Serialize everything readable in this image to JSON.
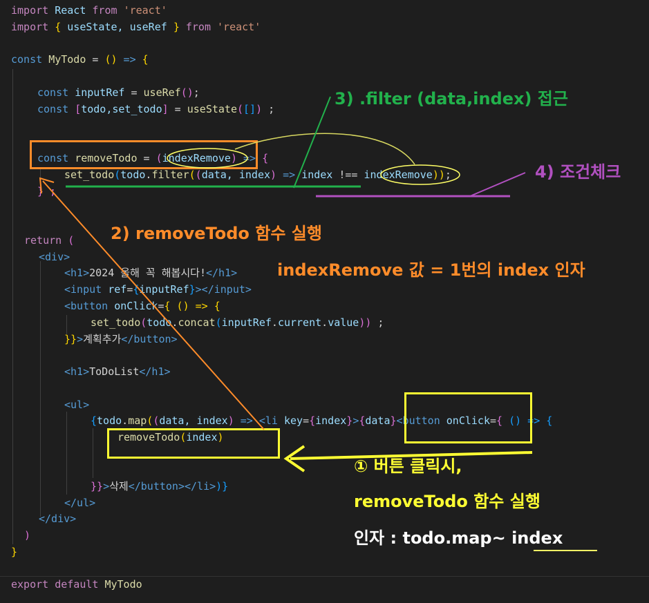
{
  "code": {
    "l1_import": "import",
    "l1_react": "React",
    "l1_from": "from",
    "l1_str": "'react'",
    "l2_import": "import",
    "l2_brace_open": "{",
    "l2_names": " useState, useRef ",
    "l2_brace_close": "}",
    "l2_from": "from",
    "l2_str": "'react'",
    "l3_const": "const",
    "l3_name": "MyTodo",
    "l3_eq": " = ",
    "l3_parens": "()",
    "l3_arrow": " => ",
    "l3_brace": "{",
    "l4_const": "const",
    "l4_var": "inputRef",
    "l4_eq": " = ",
    "l4_fn": "useRef",
    "l4_parens": "()",
    "l4_semi": ";",
    "l5_const": "const",
    "l5_open": "[",
    "l5_vars": "todo,set_todo",
    "l5_close": "]",
    "l5_eq": " = ",
    "l5_fn": "useState",
    "l5_p1": "(",
    "l5_arr": "[]",
    "l5_p2": ")",
    "l5_semi": " ;",
    "l6_const": "const",
    "l6_name": "removeTodo",
    "l6_eq": " = ",
    "l6_p1": "(",
    "l6_param": "indexRemove",
    "l6_p2": ")",
    "l6_arrow": " => ",
    "l6_brace": "{",
    "l7_fn": "set_todo",
    "l7_p1": "(",
    "l7_todo": "todo",
    "l7_dot": ".",
    "l7_filter": "filter",
    "l7_p2": "(",
    "l7_p3": "(",
    "l7_params": "data, index",
    "l7_p4": ")",
    "l7_arrow": " => ",
    "l7_index": "index",
    "l7_op": " !== ",
    "l7_ir": "indexRemove",
    "l7_p5": "))",
    "l7_semi": ";",
    "l8_close": "} ;",
    "l9_return": "return",
    "l9_paren": " (",
    "l10_div": "<div>",
    "l11_open": "<h1>",
    "l11_text": "2024 올해 꼭 해봅시다!",
    "l11_close": "</h1>",
    "l12_open": "<input",
    "l12_attr": " ref",
    "l12_eq": "=",
    "l12_b1": "{",
    "l12_val": "inputRef",
    "l12_b2": "}",
    "l12_close": "></input>",
    "l13_open": "<button",
    "l13_attr": " onClick",
    "l13_eq": "=",
    "l13_b1": "{",
    "l13_rest": " () => {",
    "l14_fn": "set_todo",
    "l14_p1": "(",
    "l14_todo": "todo",
    "l14_dot1": ".",
    "l14_concat": "concat",
    "l14_p2": "(",
    "l14_ref": "inputRef",
    "l14_dot2": ".",
    "l14_current": "current",
    "l14_dot3": ".",
    "l14_value": "value",
    "l14_p3": "))",
    "l14_semi": " ;",
    "l15_b": "}}",
    "l15_gt": ">",
    "l15_text": "계획추가",
    "l15_close": "</button>",
    "l16_open": "<h1>",
    "l16_text": "ToDoList",
    "l16_close": "</h1>",
    "l17_ul": "<ul>",
    "l18_b1": "{",
    "l18_todo": "todo",
    "l18_dot": ".",
    "l18_map": "map",
    "l18_p1": "(",
    "l18_p2": "(",
    "l18_params": "data, index",
    "l18_p3": ")",
    "l18_arrow": " => ",
    "l18_li": "<li",
    "l18_key": " key",
    "l18_eq": "=",
    "l18_kb1": "{",
    "l18_kval": "index",
    "l18_kb2": "}",
    "l18_gt": ">",
    "l18_db1": "{",
    "l18_dval": "data",
    "l18_db2": "}",
    "l18_btn": "<button",
    "l18_attr": " onClick",
    "l18_eq2": "=",
    "l18_bb": "{",
    "l18_rest": " () => {",
    "l19_fn": "removeTodo",
    "l19_p1": "(",
    "l19_arg": "index",
    "l19_p2": ")",
    "l20_b": "}}",
    "l20_gt": ">",
    "l20_text": "삭제",
    "l20_close": "</button></li>",
    "l20_b2": ")}",
    "l21_ul": "</ul>",
    "l22_div": "</div>",
    "l23_paren": ")",
    "l24_brace": "}",
    "l25_export": "export",
    "l25_default": "default",
    "l25_name": "MyTodo"
  },
  "annotations": {
    "step3": "3) .filter (data,index) 접근",
    "step4": "4) 조건체크",
    "step2": "2) removeTodo 함수 실행",
    "index_value": "indexRemove 값 = 1번의 index 인자",
    "step1_line1": "① 버튼 클릭시,",
    "step1_line2": "removeTodo 함수 실행",
    "step1_line3_prefix": "인자 : todo.map~ ",
    "step1_line3_index": "index"
  },
  "colors": {
    "background": "#1e1e1e",
    "orange": "#ff8c2a",
    "green": "#22b14c",
    "purple": "#b150c0",
    "yellow": "#ffff33",
    "white": "#ffffff"
  }
}
